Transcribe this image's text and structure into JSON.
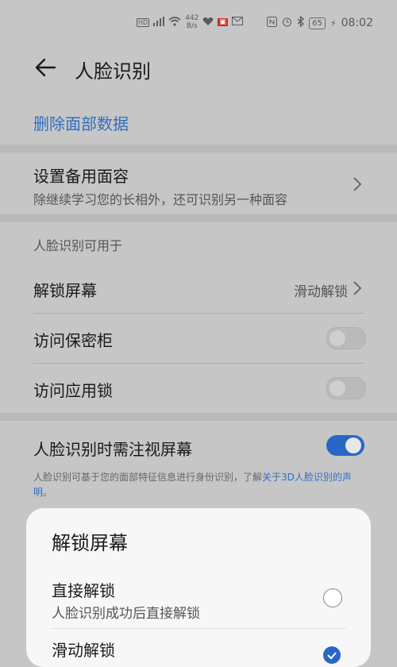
{
  "status_bar": {
    "left_icons": [
      "hd-icon",
      "signal-icon",
      "wifi-icon"
    ],
    "net_speed_value": "442",
    "net_speed_unit": "B/s",
    "time": "08:02",
    "battery": "65"
  },
  "header": {
    "title": "人脸识别"
  },
  "delete_link": "删除面部数据",
  "backup_face": {
    "title": "设置备用面容",
    "subtitle": "除继续学习您的长相外，还可识别另一种面容"
  },
  "usable_section": {
    "header": "人脸识别可用于",
    "unlock_screen": {
      "label": "解锁屏幕",
      "value": "滑动解锁"
    },
    "vault": {
      "label": "访问保密柜",
      "enabled": false
    },
    "app_lock": {
      "label": "访问应用锁",
      "enabled": false
    }
  },
  "gaze": {
    "label": "人脸识别时需注视屏幕",
    "enabled": true
  },
  "note": {
    "text": "人脸识别可基于您的面部特征信息进行身份识别，了解",
    "link": "关于3D人脸识别的声明",
    "end": "。"
  },
  "sheet": {
    "title": "解锁屏幕",
    "options": [
      {
        "title": "直接解锁",
        "subtitle": "人脸识别成功后直接解锁",
        "selected": false
      },
      {
        "title": "滑动解锁",
        "selected": true
      }
    ]
  },
  "colors": {
    "accent": "#2a66c6",
    "link": "#2f6fc4",
    "dim_background": "#c6c6c6"
  }
}
